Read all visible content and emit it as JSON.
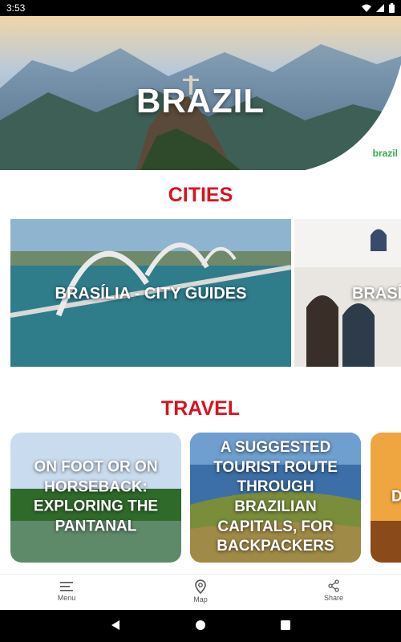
{
  "status_bar": {
    "time": "3:53"
  },
  "hero": {
    "title": "BRAZIL",
    "logo": "brazil"
  },
  "sections": {
    "cities": "CITIES",
    "travel": "TRAVEL"
  },
  "cities": [
    {
      "label": "BRASÍLIA - CITY GUIDES"
    },
    {
      "label": "BRASÍ"
    }
  ],
  "travel": [
    {
      "label": "ON FOOT OR ON HORSEBACK: EXPLORING THE PANTANAL"
    },
    {
      "label": "A SUGGESTED TOURIST ROUTE THROUGH BRAZILIAN CAPITALS, FOR BACKPACKERS"
    },
    {
      "label": "D"
    }
  ],
  "bottom_nav": [
    {
      "label": "Menu",
      "icon": "menu-icon"
    },
    {
      "label": "Map",
      "icon": "map-pin-icon"
    },
    {
      "label": "Share",
      "icon": "share-icon"
    }
  ],
  "colors": {
    "accent": "#d9121e",
    "status_bar": "#000000",
    "logo": "#2fa84f"
  }
}
